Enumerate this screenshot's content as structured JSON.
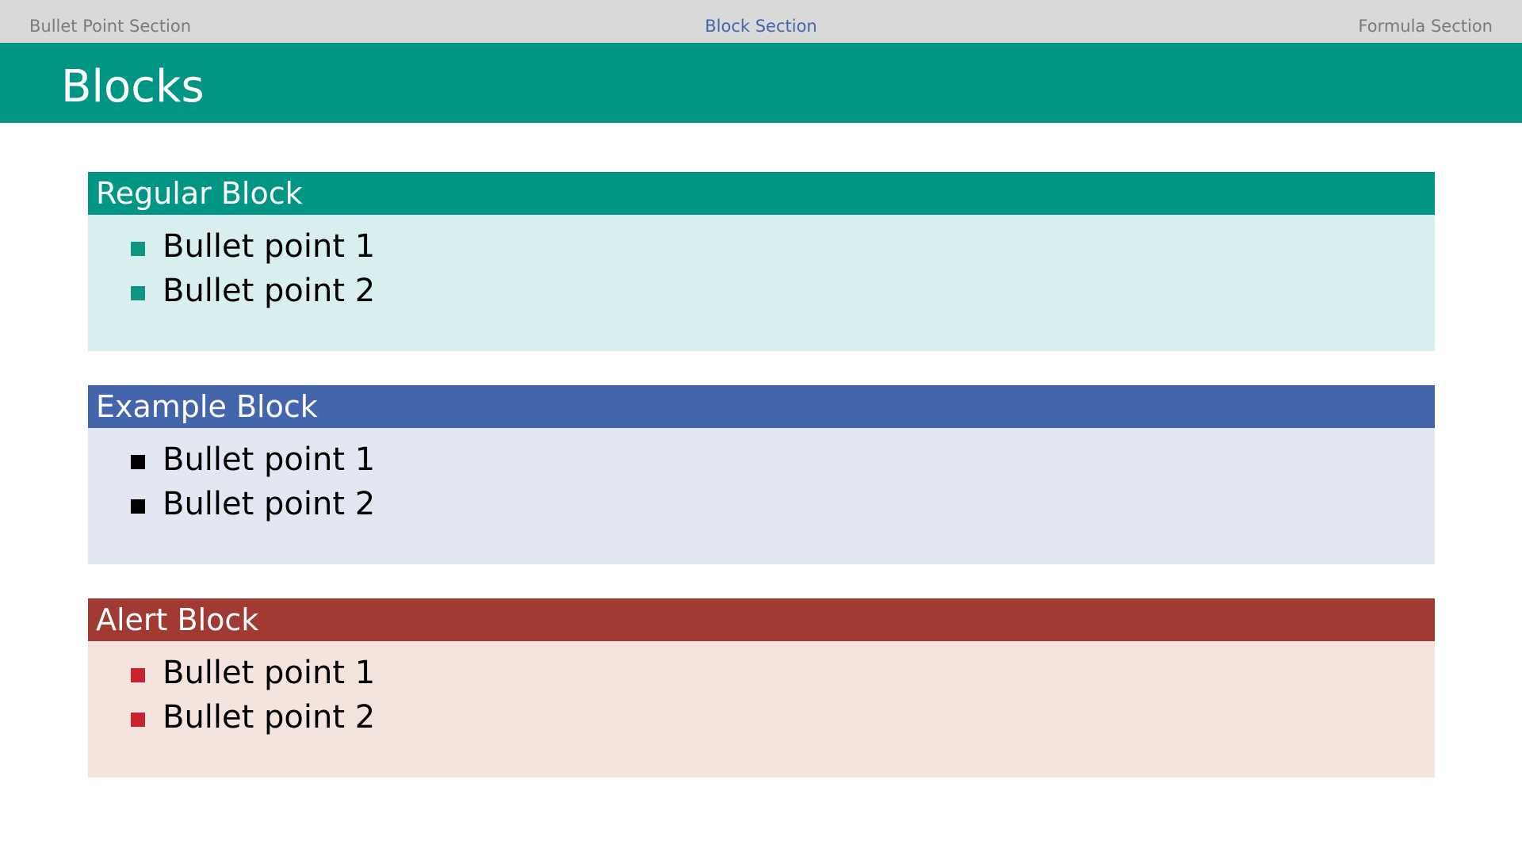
{
  "nav": {
    "left": "Bullet Point Section",
    "center": "Block Section",
    "right": "Formula Section"
  },
  "slide_title": "Blocks",
  "blocks": [
    {
      "title": "Regular Block",
      "items": [
        "Bullet point 1",
        "Bullet point 2"
      ]
    },
    {
      "title": "Example Block",
      "items": [
        "Bullet point 1",
        "Bullet point 2"
      ]
    },
    {
      "title": "Alert Block",
      "items": [
        "Bullet point 1",
        "Bullet point 2"
      ]
    }
  ],
  "colors": {
    "nav_background": "#d9d9d9",
    "nav_text": "#7a7a7a",
    "nav_active": "#4464ab",
    "title_bar": "#009683",
    "regular_header": "#009683",
    "regular_body": "#d9eeee",
    "regular_bullet": "#0f9683",
    "example_header": "#4464ab",
    "example_body": "#e3e7f1",
    "example_bullet": "#000000",
    "alert_header": "#a03a33",
    "alert_body": "#f4e4de",
    "alert_bullet": "#c8232f"
  }
}
